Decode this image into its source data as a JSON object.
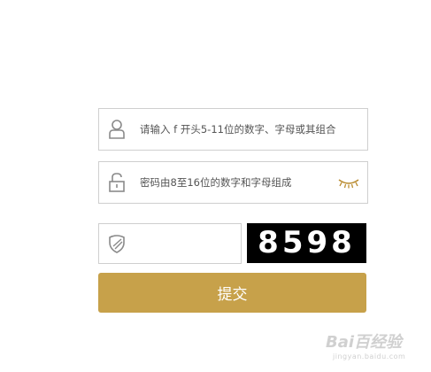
{
  "form": {
    "username_placeholder": "请输入 f 开头5-11位的数字、字母或其组合",
    "password_placeholder": "密码由8至16位的数字和字母组成",
    "captcha_value": "",
    "captcha_code": "8598",
    "submit_label": "提交"
  },
  "icons": {
    "username": "user-icon",
    "password": "unlock-icon",
    "password_toggle": "eye-closed-icon",
    "captcha": "shield-icon"
  },
  "colors": {
    "accent": "#c7a14a",
    "border": "#cfcfcf",
    "captcha_bg": "#000000",
    "captcha_text": "#ffffff",
    "eye_icon": "#b98b2f"
  },
  "watermark": {
    "main": "Bai百经验",
    "sub": "jingyan.baidu.com"
  }
}
